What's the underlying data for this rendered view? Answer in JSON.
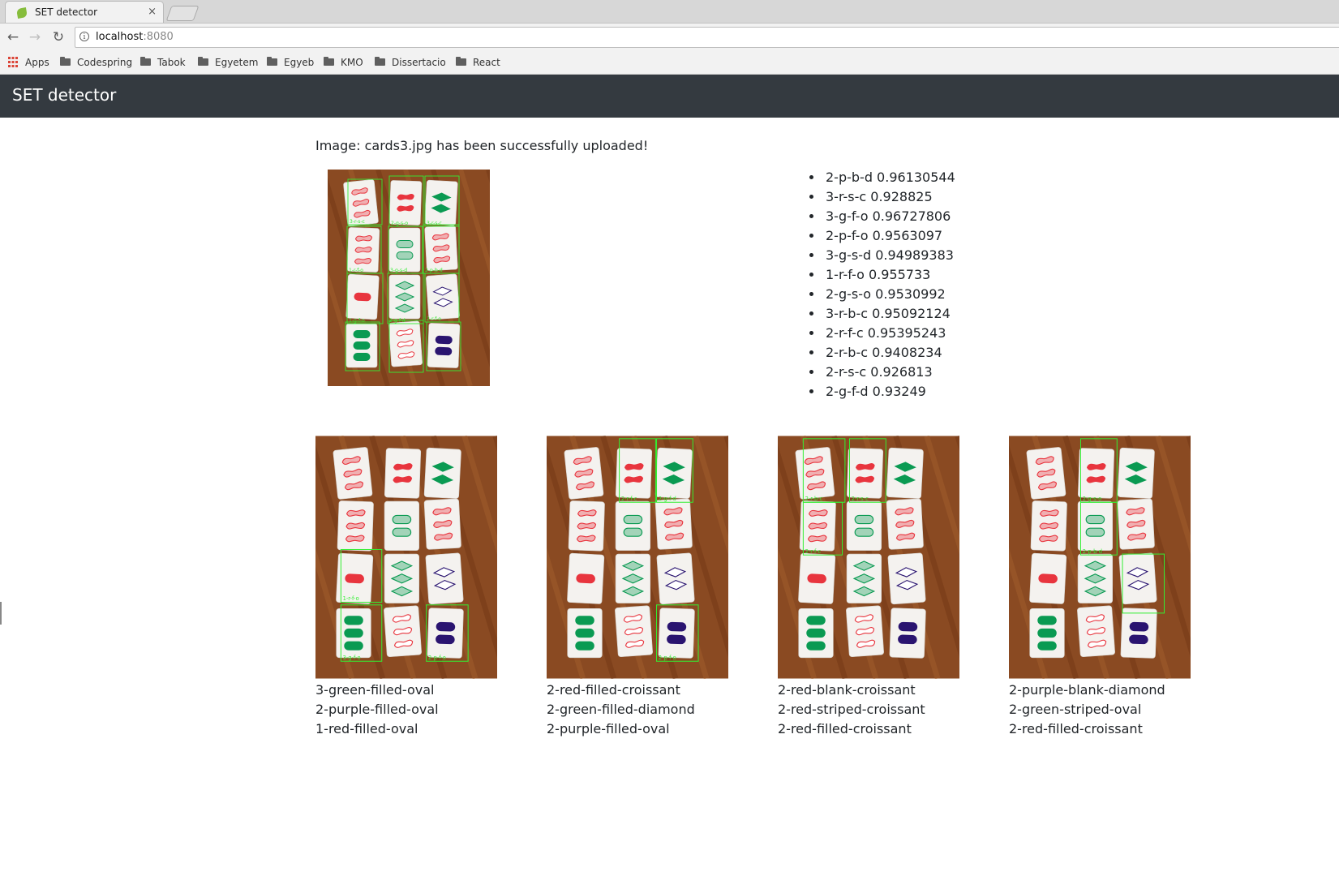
{
  "browser": {
    "tab_title": "SET detector",
    "close_glyph": "×",
    "url_host": "localhost",
    "url_port": ":8080",
    "info_glyph": "i",
    "bookmarks": [
      "Apps",
      "Codespring",
      "Tabok",
      "Egyetem",
      "Egyeb",
      "KMO",
      "Dissertacio",
      "React"
    ]
  },
  "navbar": {
    "brand": "SET detector"
  },
  "upload": {
    "message": "Image: cards3.jpg has been successfully uploaded!"
  },
  "predictions": [
    "2-p-b-d 0.96130544",
    "3-r-s-c 0.928825",
    "3-g-f-o 0.96727806",
    "2-p-f-o 0.9563097",
    "3-g-s-d 0.94989383",
    "1-r-f-o 0.955733",
    "2-g-s-o 0.9530992",
    "3-r-b-c 0.95092124",
    "2-r-f-c 0.95395243",
    "2-r-b-c 0.9408234",
    "2-r-s-c 0.926813",
    "2-g-f-d 0.93249"
  ],
  "main_photo_labels": [
    "3-r-s-c",
    "2-g-s-o",
    "3-r-s-c",
    "1-r-f-o",
    "3-g-s-d",
    "2-p-b-d",
    "1-g-f-o",
    "2-g-f-d",
    "2-r-f-o",
    "2-g-f-d"
  ],
  "sets": [
    {
      "cards": [
        "3-green-filled-oval",
        "2-purple-filled-oval",
        "1-red-filled-oval"
      ],
      "labels": [
        "1-r-f-o",
        "3-g-f-o",
        "2-p-f-o"
      ]
    },
    {
      "cards": [
        "2-red-filled-croissant",
        "2-green-filled-diamond",
        "2-purple-filled-oval"
      ],
      "labels": [
        "2-r-f-c",
        "2-g-f-d",
        "2-p-f-o"
      ]
    },
    {
      "cards": [
        "2-red-blank-croissant",
        "2-red-striped-croissant",
        "2-red-filled-croissant"
      ],
      "labels": [
        "2-r-b-c",
        "2-r-s-c",
        "2-r-f-c"
      ]
    },
    {
      "cards": [
        "2-purple-blank-diamond",
        "2-green-striped-oval",
        "2-red-filled-croissant"
      ],
      "labels": [
        "2-g-s-o",
        "2-p-b-d"
      ]
    }
  ],
  "colors": {
    "navbar": "#343a40",
    "wood": "#8a4a22",
    "card_red": "#e8353e",
    "card_green": "#0a9a52",
    "card_purple": "#2a1470",
    "detect_box": "#33ee33"
  }
}
